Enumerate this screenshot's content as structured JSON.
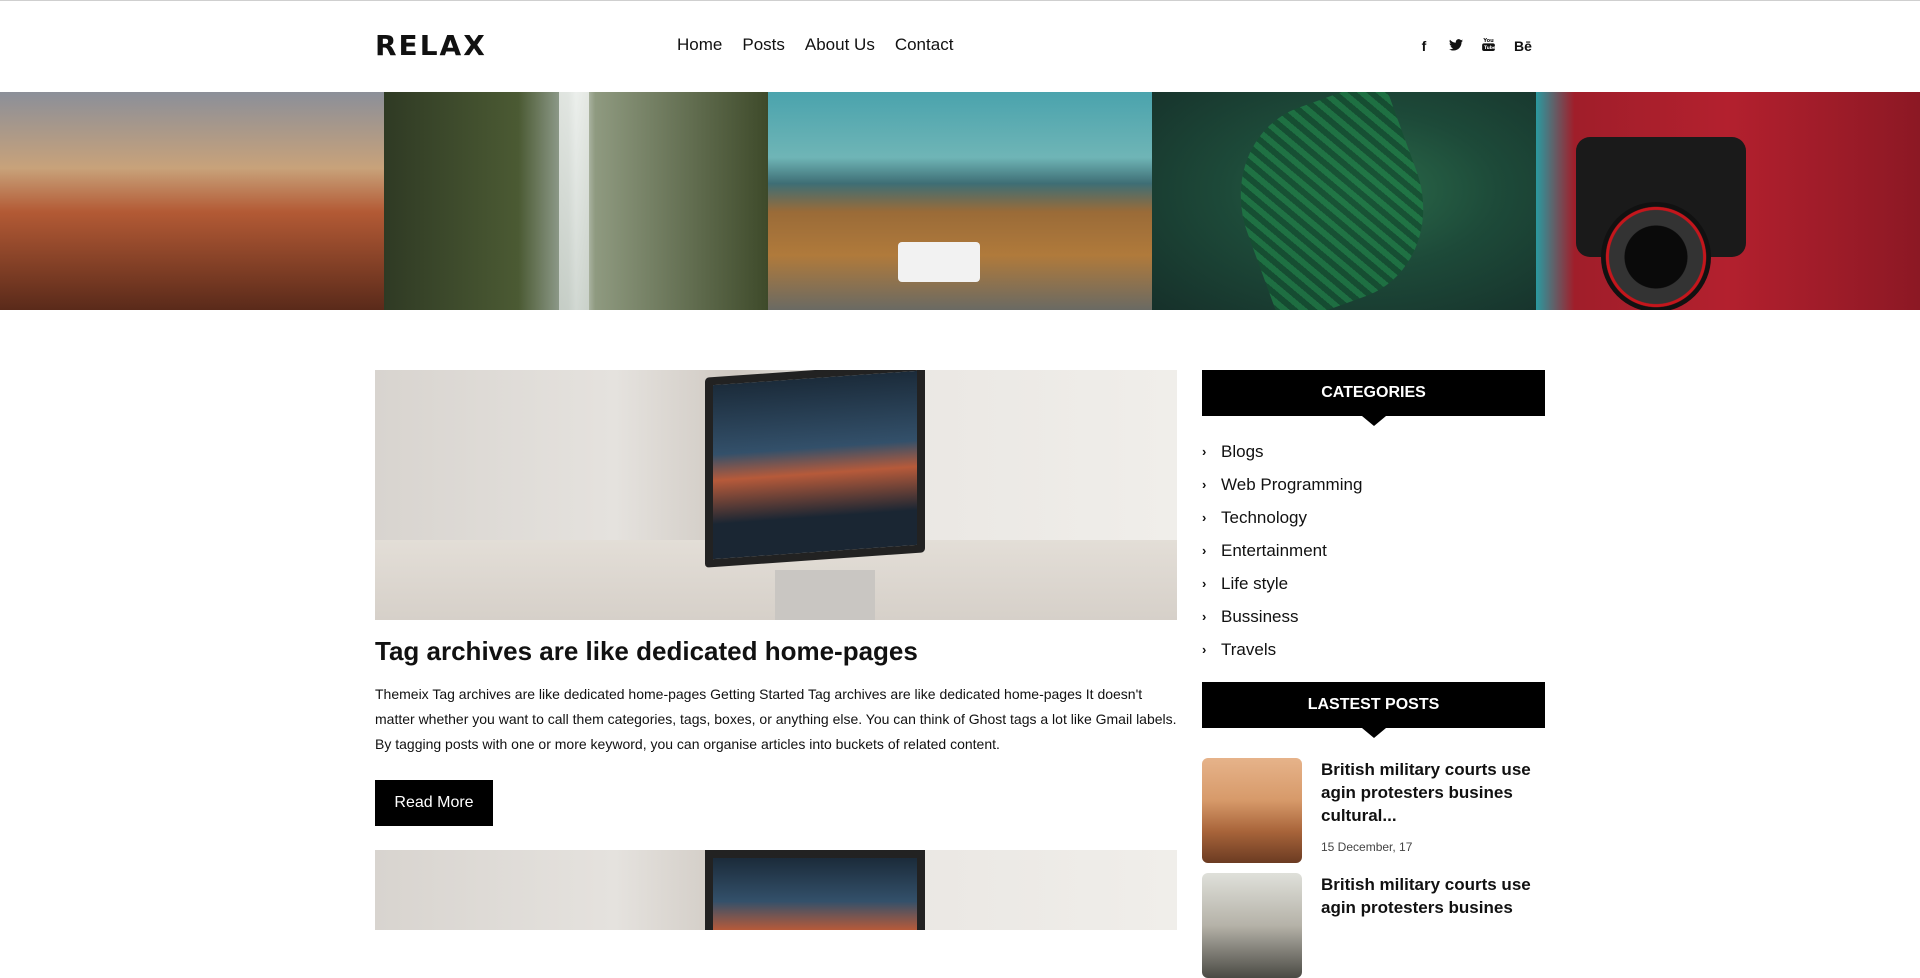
{
  "site": {
    "logo": "RELAX"
  },
  "nav": [
    {
      "label": "Home"
    },
    {
      "label": "Posts"
    },
    {
      "label": "About Us"
    },
    {
      "label": "Contact"
    }
  ],
  "social": [
    {
      "icon": "facebook-icon",
      "glyph": "f"
    },
    {
      "icon": "twitter-icon",
      "glyph": "🐦"
    },
    {
      "icon": "youtube-icon",
      "glyph": "▶"
    },
    {
      "icon": "behance-icon",
      "glyph": "Bē"
    }
  ],
  "gallery": [
    {
      "subject": "brick-canal-buildings"
    },
    {
      "subject": "waterfall-bridge"
    },
    {
      "subject": "landscape-with-jeep"
    },
    {
      "subject": "fern-leaves"
    },
    {
      "subject": "camera-red-jacket"
    }
  ],
  "article": {
    "title": "Tag archives are like dedicated home-pages",
    "excerpt": "Themeix Tag archives are like dedicated home-pages Getting Started Tag archives are like dedicated home-pages It doesn't matter whether you want to call them categories, tags, boxes, or anything else. You can think of Ghost tags a lot like Gmail labels. By tagging posts with one or more keyword, you can organise articles into buckets of related content.",
    "read_more": "Read More"
  },
  "sidebar": {
    "categories_title": "CATEGORIES",
    "categories": [
      {
        "label": "Blogs"
      },
      {
        "label": "Web Programming"
      },
      {
        "label": "Technology"
      },
      {
        "label": "Entertainment"
      },
      {
        "label": "Life style"
      },
      {
        "label": "Bussiness"
      },
      {
        "label": "Travels"
      }
    ],
    "latest_title": "LASTEST POSTS",
    "posts": [
      {
        "title": "British military courts use agin protesters busines cultural...",
        "date": "15 December, 17"
      },
      {
        "title": "British military courts use agin protesters busines",
        "date": ""
      }
    ]
  },
  "colors": {
    "accent": "#000000",
    "text": "#111111",
    "background": "#ffffff"
  }
}
